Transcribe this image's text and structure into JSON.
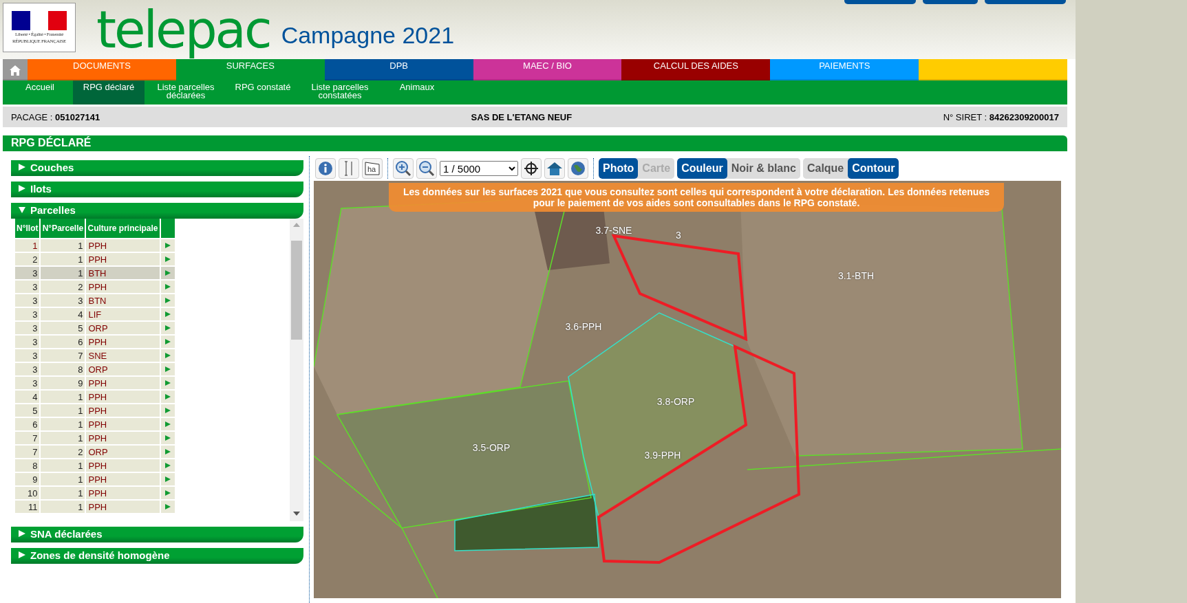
{
  "header": {
    "logo_text": "telepac",
    "campaign": "Campagne 2021",
    "marianne": {
      "motto": "Liberté • Égalité • Fraternité",
      "republic": "RÉPUBLIQUE FRANÇAISE"
    }
  },
  "main_menu": [
    {
      "kind": "home",
      "selected": false,
      "color": "#999999"
    },
    {
      "label": "DOCUMENTS",
      "kind": "text",
      "selected": false,
      "color": "#ff6600"
    },
    {
      "label": "SURFACES",
      "kind": "text",
      "selected": true,
      "color": "#009933"
    },
    {
      "label": "DPB",
      "kind": "text",
      "selected": false,
      "color": "#00529b"
    },
    {
      "label": "MAEC / BIO",
      "kind": "text",
      "selected": false,
      "color": "#cc3399"
    },
    {
      "label": "CALCUL DES AIDES",
      "kind": "text",
      "selected": false,
      "color": "#990000"
    },
    {
      "label": "PAIEMENTS",
      "kind": "text",
      "selected": false,
      "color": "#0099ff"
    },
    {
      "kind": "blank",
      "selected": false,
      "color": "#ffcc00"
    }
  ],
  "sub_menu": [
    {
      "label": "Accueil",
      "selected": false
    },
    {
      "label": "RPG déclaré",
      "selected": true
    },
    {
      "label": "Liste parcelles déclarées",
      "selected": false
    },
    {
      "label": "RPG constaté",
      "selected": false
    },
    {
      "label": "Liste parcelles constatées",
      "selected": false
    },
    {
      "label": "Animaux",
      "selected": false
    }
  ],
  "info_bar": {
    "pacage_label": "PACAGE :",
    "pacage": "051027141",
    "company": "SAS DE L'ETANG NEUF",
    "siret_label": "N° SIRET :",
    "siret": "84262309200017"
  },
  "page_title": "RPG DÉCLARÉ",
  "sections_before": [
    {
      "title": "Couches",
      "expanded": false
    },
    {
      "title": "Ilots",
      "expanded": false
    },
    {
      "title": "Parcelles",
      "expanded": true
    }
  ],
  "table": {
    "columns": [
      "N°Ilot",
      "N°Parcelle",
      "Culture principale"
    ],
    "rows": [
      {
        "ilot": "1",
        "parcelle": "1",
        "culture": "PPH",
        "selected": false
      },
      {
        "ilot": "2",
        "parcelle": "1",
        "culture": "PPH",
        "selected": false
      },
      {
        "ilot": "3",
        "parcelle": "1",
        "culture": "BTH",
        "selected": true
      },
      {
        "ilot": "3",
        "parcelle": "2",
        "culture": "PPH",
        "selected": false
      },
      {
        "ilot": "3",
        "parcelle": "3",
        "culture": "BTN",
        "selected": false
      },
      {
        "ilot": "3",
        "parcelle": "4",
        "culture": "LIF",
        "selected": false
      },
      {
        "ilot": "3",
        "parcelle": "5",
        "culture": "ORP",
        "selected": false
      },
      {
        "ilot": "3",
        "parcelle": "6",
        "culture": "PPH",
        "selected": false
      },
      {
        "ilot": "3",
        "parcelle": "7",
        "culture": "SNE",
        "selected": false
      },
      {
        "ilot": "3",
        "parcelle": "8",
        "culture": "ORP",
        "selected": false
      },
      {
        "ilot": "3",
        "parcelle": "9",
        "culture": "PPH",
        "selected": false
      },
      {
        "ilot": "4",
        "parcelle": "1",
        "culture": "PPH",
        "selected": false
      },
      {
        "ilot": "5",
        "parcelle": "1",
        "culture": "PPH",
        "selected": false
      },
      {
        "ilot": "6",
        "parcelle": "1",
        "culture": "PPH",
        "selected": false
      },
      {
        "ilot": "7",
        "parcelle": "1",
        "culture": "PPH",
        "selected": false
      },
      {
        "ilot": "7",
        "parcelle": "2",
        "culture": "ORP",
        "selected": false
      },
      {
        "ilot": "8",
        "parcelle": "1",
        "culture": "PPH",
        "selected": false
      },
      {
        "ilot": "9",
        "parcelle": "1",
        "culture": "PPH",
        "selected": false
      },
      {
        "ilot": "10",
        "parcelle": "1",
        "culture": "PPH",
        "selected": false
      },
      {
        "ilot": "11",
        "parcelle": "1",
        "culture": "PPH",
        "selected": false
      }
    ]
  },
  "sections_after": [
    {
      "title": "SNA déclarées",
      "expanded": false
    },
    {
      "title": "Zones de densité homogène",
      "expanded": false
    }
  ],
  "toolbar": {
    "area_icon_text": "ha",
    "scale": "1 / 5000",
    "toggle_groups": [
      [
        {
          "label": "Photo",
          "selected": true,
          "disabled": false
        },
        {
          "label": "Carte",
          "selected": false,
          "disabled": true
        }
      ],
      [
        {
          "label": "Couleur",
          "selected": true,
          "disabled": false
        },
        {
          "label": "Noir & blanc",
          "selected": false,
          "disabled": false
        }
      ],
      [
        {
          "label": "Calque",
          "selected": false,
          "disabled": false
        },
        {
          "label": "Contour",
          "selected": true,
          "disabled": false
        }
      ]
    ]
  },
  "map": {
    "notice": "Les données sur les surfaces 2021 que vous consultez sont celles qui correspondent à votre déclaration. Les données retenues pour le paiement de vos aides sont consultables dans le RPG constaté.",
    "labels": [
      "3.7-SNE",
      "3",
      "3.1-BTH",
      "3.6-PPH",
      "3.8-ORP",
      "3.5-ORP",
      "3.9-PPH"
    ]
  }
}
